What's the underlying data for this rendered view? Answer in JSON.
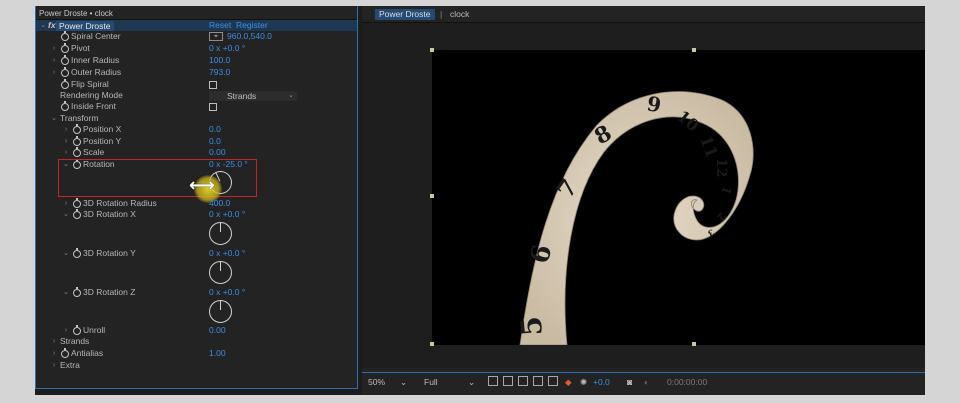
{
  "panel": {
    "title": "Power Droste • clock",
    "effect_name": "Power Droste",
    "fx": "fx",
    "reset": "Reset",
    "register": "Register"
  },
  "params": {
    "spiral_center": {
      "label": "Spiral Center",
      "value": "960.0,540.0"
    },
    "pivot": {
      "label": "Pivot",
      "value": "0 x +0.0 °"
    },
    "inner_radius": {
      "label": "Inner Radius",
      "value": "100.0"
    },
    "outer_radius": {
      "label": "Outer Radius",
      "value": "793.0"
    },
    "flip_spiral": {
      "label": "Flip Spiral"
    },
    "rendering_mode": {
      "label": "Rendering Mode",
      "value": "Strands"
    },
    "inside_front": {
      "label": "Inside Front"
    },
    "transform": {
      "label": "Transform"
    },
    "position_x": {
      "label": "Position X",
      "value": "0.0"
    },
    "position_y": {
      "label": "Position Y",
      "value": "0.0"
    },
    "scale": {
      "label": "Scale",
      "value": "0.00"
    },
    "rotation": {
      "label": "Rotation",
      "value": "0 x -25.0 °"
    },
    "rot3d_radius": {
      "label": "3D Rotation Radius",
      "value": "400.0"
    },
    "rot3d_x": {
      "label": "3D Rotation X",
      "value": "0 x +0.0 °"
    },
    "rot3d_y": {
      "label": "3D Rotation Y",
      "value": "0 x +0.0 °"
    },
    "rot3d_z": {
      "label": "3D Rotation Z",
      "value": "0 x +0.0 °"
    },
    "unroll": {
      "label": "Unroll",
      "value": "0.00"
    },
    "strands": {
      "label": "Strands"
    },
    "antialias": {
      "label": "Antialias",
      "value": "1.00"
    },
    "extra": {
      "label": "Extra"
    }
  },
  "composition": {
    "tab_label": "Power Droste",
    "tab_sep": "|",
    "tab2_label": "clock",
    "clock_numerals": [
      "9",
      "10",
      "11",
      "12",
      "1",
      "2",
      "3",
      "8",
      "7",
      "6",
      "5"
    ]
  },
  "footer": {
    "zoom": "50%",
    "resolution": "Full",
    "exposure": "+0.0",
    "timecode": "0:00:00:00"
  }
}
